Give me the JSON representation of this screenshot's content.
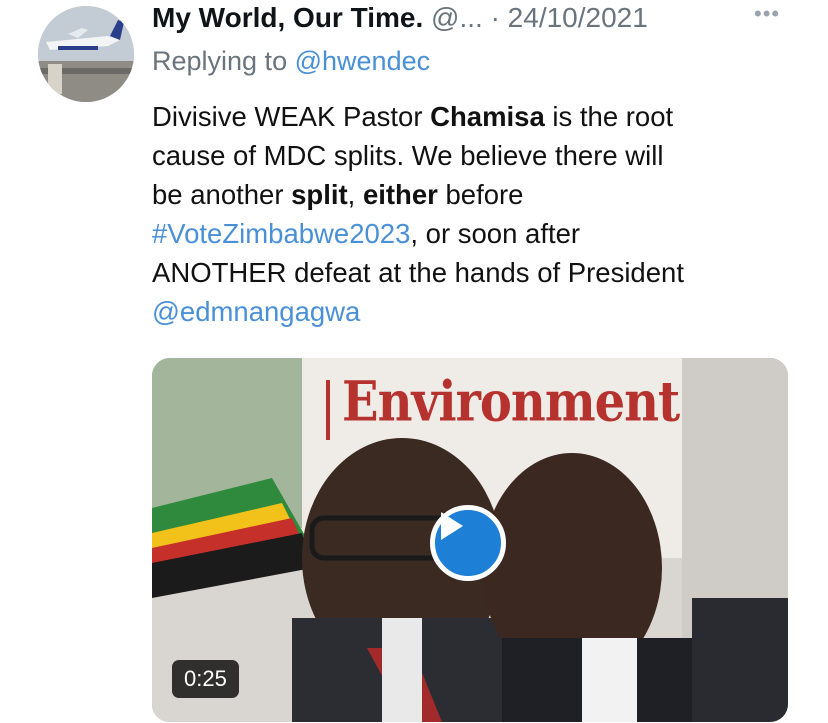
{
  "tweet": {
    "author": {
      "display_name": "My World, Our Time.",
      "handle": "@...",
      "separator": "·",
      "date": "24/10/2021",
      "more_icon": "more-dots-icon"
    },
    "replying_label": "Replying to",
    "replying_to": "@hwendec",
    "body": {
      "l1_a": "Divisive WEAK Pastor ",
      "l1_b": "Chamisa",
      "l1_c": " is the root",
      "l2": "cause of MDC splits. We believe there will",
      "l3_a": "be another ",
      "l3_b": "split",
      "l3_c": ", ",
      "l3_d": "either",
      "l3_e": " before",
      "l4_hashtag": "#VoteZimbabwe2023",
      "l4_rest": ", or soon after",
      "l5": "ANOTHER defeat at the hands of President",
      "l6_mention": "@edmnangagwa"
    },
    "media": {
      "banner_text": "Environment",
      "duration": "0:25",
      "play_icon": "play-icon"
    }
  },
  "colors": {
    "link": "#4a90d6",
    "secondary_text": "#6a747d",
    "play_button": "#1d7fd6"
  }
}
